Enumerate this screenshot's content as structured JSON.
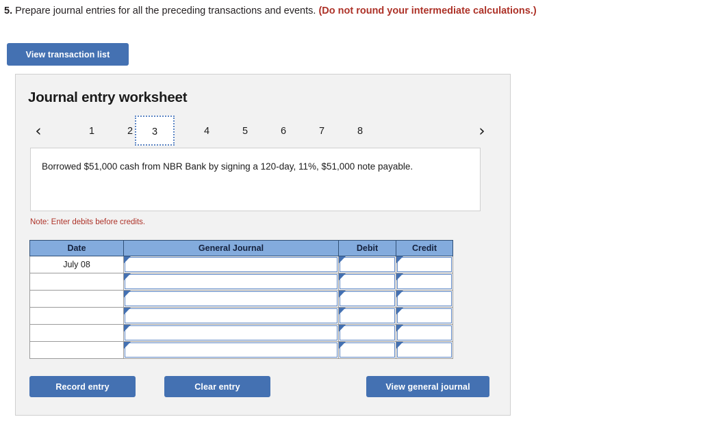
{
  "question": {
    "number": "5.",
    "text": "Prepare journal entries for all the preceding transactions and events.",
    "warning": "(Do not round your intermediate calculations.)"
  },
  "toolbar": {
    "view_transaction_list_label": "View transaction list"
  },
  "worksheet": {
    "title": "Journal entry worksheet",
    "pager": {
      "prev_icon": "‹",
      "next_icon": "›",
      "items": [
        {
          "label": "1",
          "active": false
        },
        {
          "label": "2",
          "active": false
        },
        {
          "label": "3",
          "active": true
        },
        {
          "label": "4",
          "active": false
        },
        {
          "label": "5",
          "active": false
        },
        {
          "label": "6",
          "active": false
        },
        {
          "label": "7",
          "active": false
        },
        {
          "label": "8",
          "active": false
        }
      ]
    },
    "transaction_text": "Borrowed $51,000 cash from NBR Bank by signing a 120-day, 11%, $51,000 note payable.",
    "note": "Note: Enter debits before credits.",
    "table": {
      "headers": [
        "Date",
        "General Journal",
        "Debit",
        "Credit"
      ],
      "rows": [
        {
          "date": "July 08",
          "general_journal": "",
          "debit": "",
          "credit": ""
        },
        {
          "date": "",
          "general_journal": "",
          "debit": "",
          "credit": ""
        },
        {
          "date": "",
          "general_journal": "",
          "debit": "",
          "credit": ""
        },
        {
          "date": "",
          "general_journal": "",
          "debit": "",
          "credit": ""
        },
        {
          "date": "",
          "general_journal": "",
          "debit": "",
          "credit": ""
        },
        {
          "date": "",
          "general_journal": "",
          "debit": "",
          "credit": ""
        }
      ]
    },
    "actions": {
      "record_entry_label": "Record entry",
      "clear_entry_label": "Clear entry",
      "view_general_journal_label": "View general journal"
    }
  },
  "colors": {
    "button_blue": "#4471b2",
    "table_header_blue": "#83abdd",
    "warning_red": "#ad3228",
    "panel_gray": "#f2f2f2"
  }
}
